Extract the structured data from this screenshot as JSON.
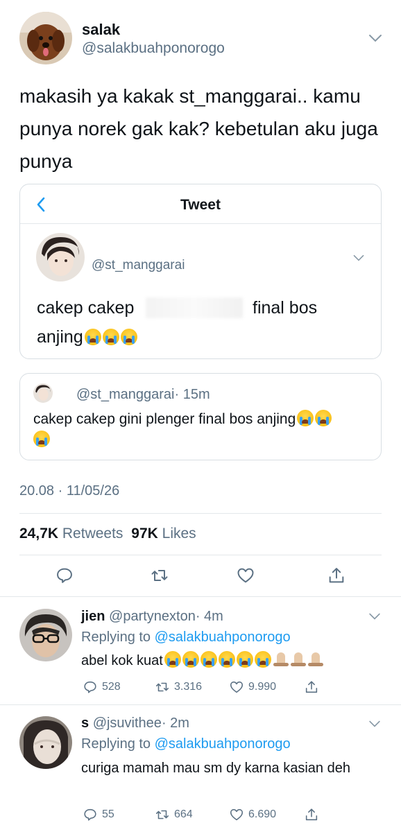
{
  "main_tweet": {
    "author_name": "salak",
    "author_handle": "@salakbuahponorogo",
    "text": "makasih ya kakak st_manggarai.. kamu punya norek gak kak? kebetulan aku juga punya",
    "timestamp": "20.08 · 11/05/26",
    "retweets_count": "24,7K",
    "retweets_label": "Retweets",
    "likes_count": "97K",
    "likes_label": "Likes"
  },
  "embedded_card": {
    "title": "Tweet",
    "handle": "@st_manggarai",
    "text_part1": "cakep cakep",
    "text_part2": "final bos",
    "text_line2": "anjing"
  },
  "quoted_tweet": {
    "handle": "@st_manggarai",
    "time": "· 15m",
    "text": "cakep cakep gini plenger final bos anjing"
  },
  "replies": [
    {
      "name": "jien",
      "handle": "@partynexton",
      "time": "· 4m",
      "replying_label": "Replying to",
      "replying_to": "@salakbuahponorogo",
      "text": "abel kok kuat",
      "replies": "528",
      "retweets": "3.316",
      "likes": "9.990"
    },
    {
      "name": "s",
      "handle": "@jsuvithee",
      "time": "· 2m",
      "replying_label": "Replying to",
      "replying_to": "@salakbuahponorogo",
      "text": "curiga mamah mau sm dy karna kasian deh",
      "replies": "55",
      "retweets": "664",
      "likes": "6.690"
    }
  ],
  "colors": {
    "accent": "#1d9bf0",
    "secondary_text": "#5b7083",
    "border": "#e3e7ea"
  }
}
